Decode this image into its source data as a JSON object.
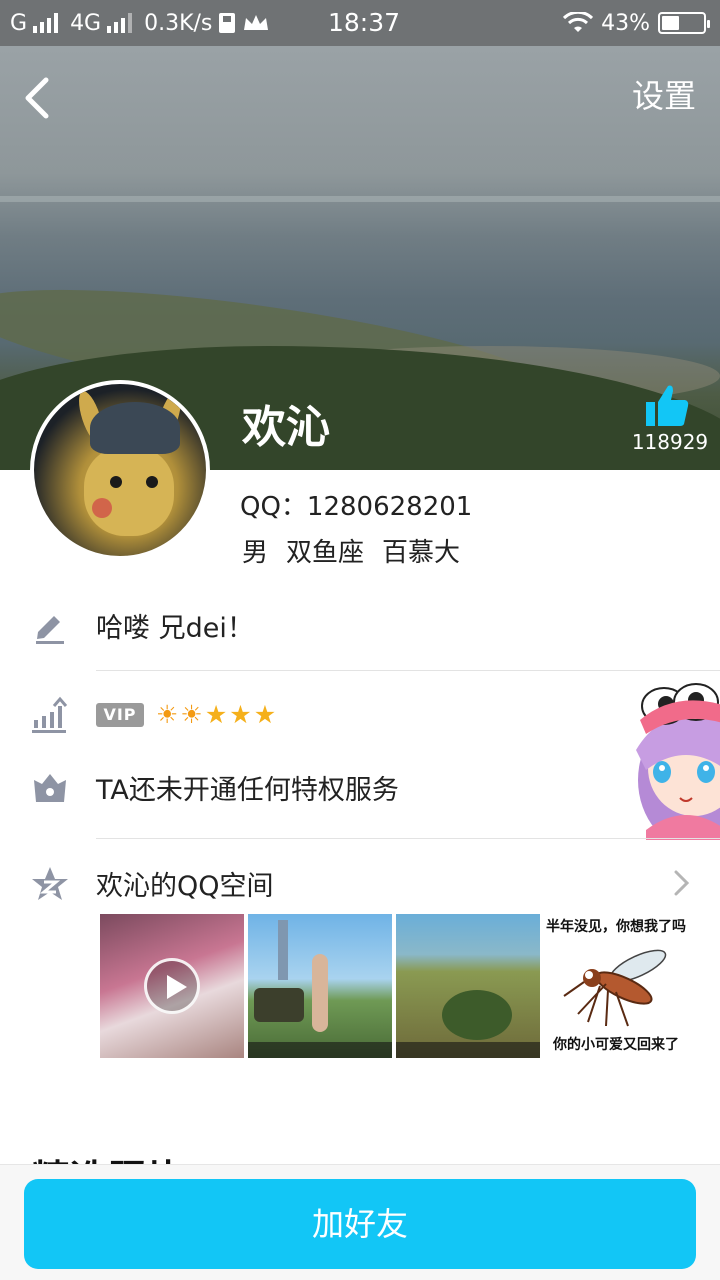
{
  "status_bar": {
    "carrier1": "G",
    "carrier2": "4G",
    "speed": "0.3K/s",
    "time": "18:37",
    "battery": "43%",
    "battery_level": 0.43,
    "icons": [
      "signal-icon",
      "sim-icon",
      "crown-icon",
      "wifi-icon",
      "battery-icon"
    ]
  },
  "header": {
    "back_icon": "back-arrow-icon",
    "settings_label": "设置"
  },
  "profile": {
    "name": "欢沁",
    "like_count": "118929",
    "qq": "QQ：1280628201",
    "gender": "男",
    "zodiac": "双鱼座",
    "school": "百慕大"
  },
  "signature": {
    "icon": "pencil-icon",
    "text": "哈喽 兄dei！"
  },
  "vip": {
    "icon": "level-icon",
    "badge": "VIP",
    "level_suns": 2,
    "level_stars": 3,
    "privilege_icon": "crown-outline-icon",
    "privilege_text": "TA还未开通任何特权服务"
  },
  "qzone": {
    "icon": "qzone-star-icon",
    "title": "欢沁的QQ空间",
    "photos": [
      {
        "type": "video"
      },
      {
        "type": "image"
      },
      {
        "type": "image"
      },
      {
        "type": "meme",
        "caption_top": "半年没见，你想我了吗",
        "caption_bottom": "你的小可爱又回来了"
      }
    ]
  },
  "featured": {
    "heading": "精选照片"
  },
  "bottom": {
    "add_friend_label": "加好友"
  },
  "colors": {
    "accent": "#12c6f6",
    "status_bar": "#6f7274",
    "text_primary": "#222222",
    "divider": "#e3e3e3"
  }
}
